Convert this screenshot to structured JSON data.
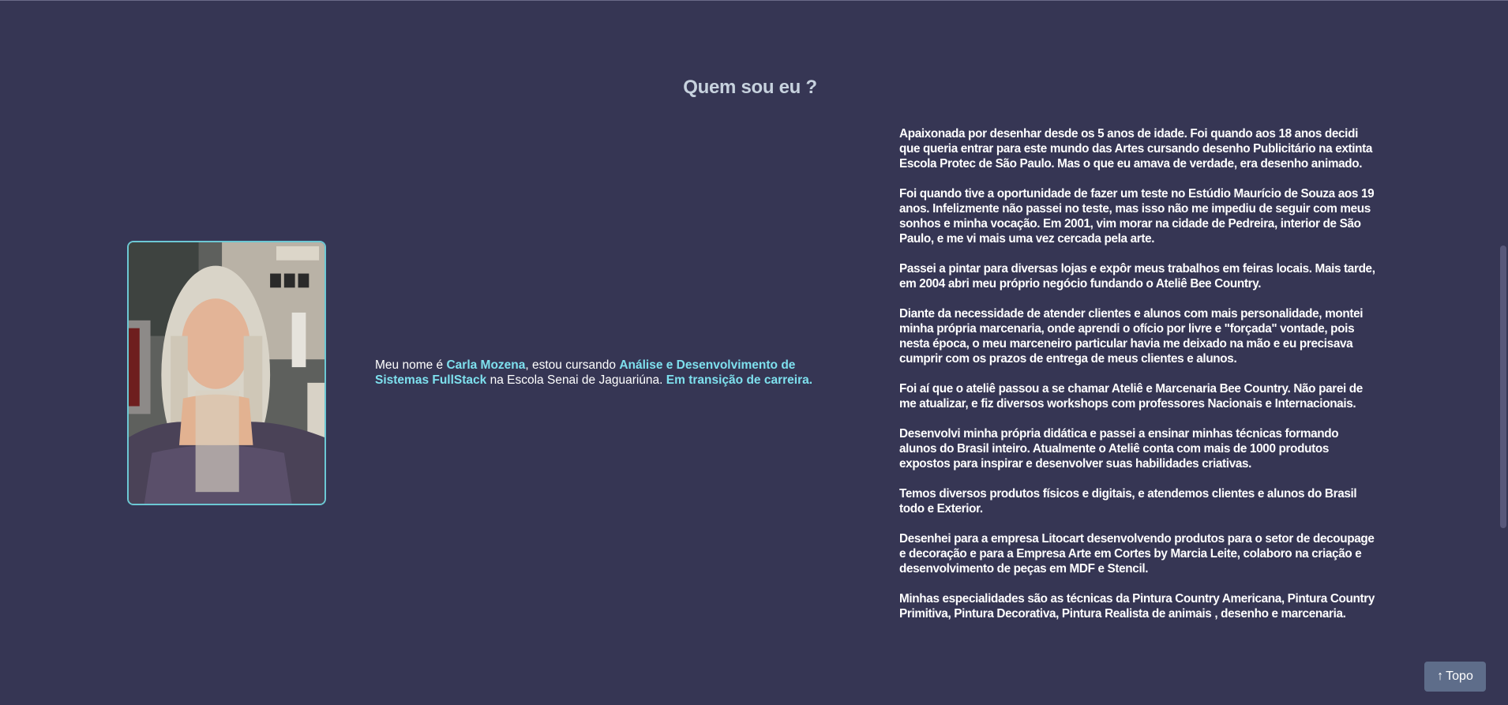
{
  "about": {
    "title": "Quem sou eu ?",
    "intro": {
      "prefix": "Meu nome é ",
      "name": "Carla Mozena",
      "mid": ", estou cursando ",
      "course": "Análise e Desenvolvimento de Sistemas FullStack",
      "school": " na Escola Senai de Jaguariúna. ",
      "career": "Em transição de carreira."
    },
    "bio": [
      "Apaixonada por desenhar desde os 5 anos de idade. Foi quando aos 18 anos decidi que queria entrar para este mundo das Artes cursando desenho Publicitário na extinta Escola Protec de São Paulo. Mas o que eu amava de verdade, era desenho animado.",
      "Foi quando tive a oportunidade de fazer um teste no Estúdio Maurício de Souza aos 19 anos. Infelizmente não passei no teste, mas isso não me impediu de seguir com meus sonhos e minha vocação. Em 2001, vim morar na cidade de Pedreira, interior de São Paulo, e me vi mais uma vez cercada pela arte.",
      "Passei a pintar para diversas lojas e expôr meus trabalhos em feiras locais. Mais tarde, em 2004 abri meu próprio negócio fundando o Ateliê Bee Country.",
      "Diante da necessidade de atender clientes e alunos com mais personalidade, montei minha própria marcenaria, onde aprendi o ofício por livre e \"forçada\" vontade, pois nesta época, o meu marceneiro particular havia me deixado na mão e eu precisava cumprir com os prazos de entrega de meus clientes e alunos.",
      "Foi aí que o ateliê passou a se chamar Ateliê e Marcenaria Bee Country. Não parei de me atualizar, e fiz diversos workshops com professores Nacionais e Internacionais.",
      "Desenvolvi minha própria didática e passei a ensinar minhas técnicas formando alunos do Brasil inteiro. Atualmente o Ateliê conta com mais de 1000 produtos expostos para inspirar e desenvolver suas habilidades criativas.",
      "Temos diversos produtos físicos e digitais, e atendemos clientes e alunos do Brasil todo e Exterior.",
      "Desenhei para a empresa Litocart desenvolvendo produtos para o setor de decoupage e decoração e para a Empresa Arte em Cortes by Marcia Leite, colaboro na criação e desenvolvimento de peças em MDF e Stencil.",
      "Minhas especialidades são as técnicas da Pintura Country Americana, Pintura Country Primitiva, Pintura Decorativa, Pintura Realista de animais , desenho e marcenaria."
    ]
  },
  "scroll_top": {
    "arrow": "↑",
    "label": "Topo"
  },
  "colors": {
    "background": "#363654",
    "highlight": "#7ee0ee",
    "title": "#c7d2de",
    "button": "#5e6d8a"
  }
}
